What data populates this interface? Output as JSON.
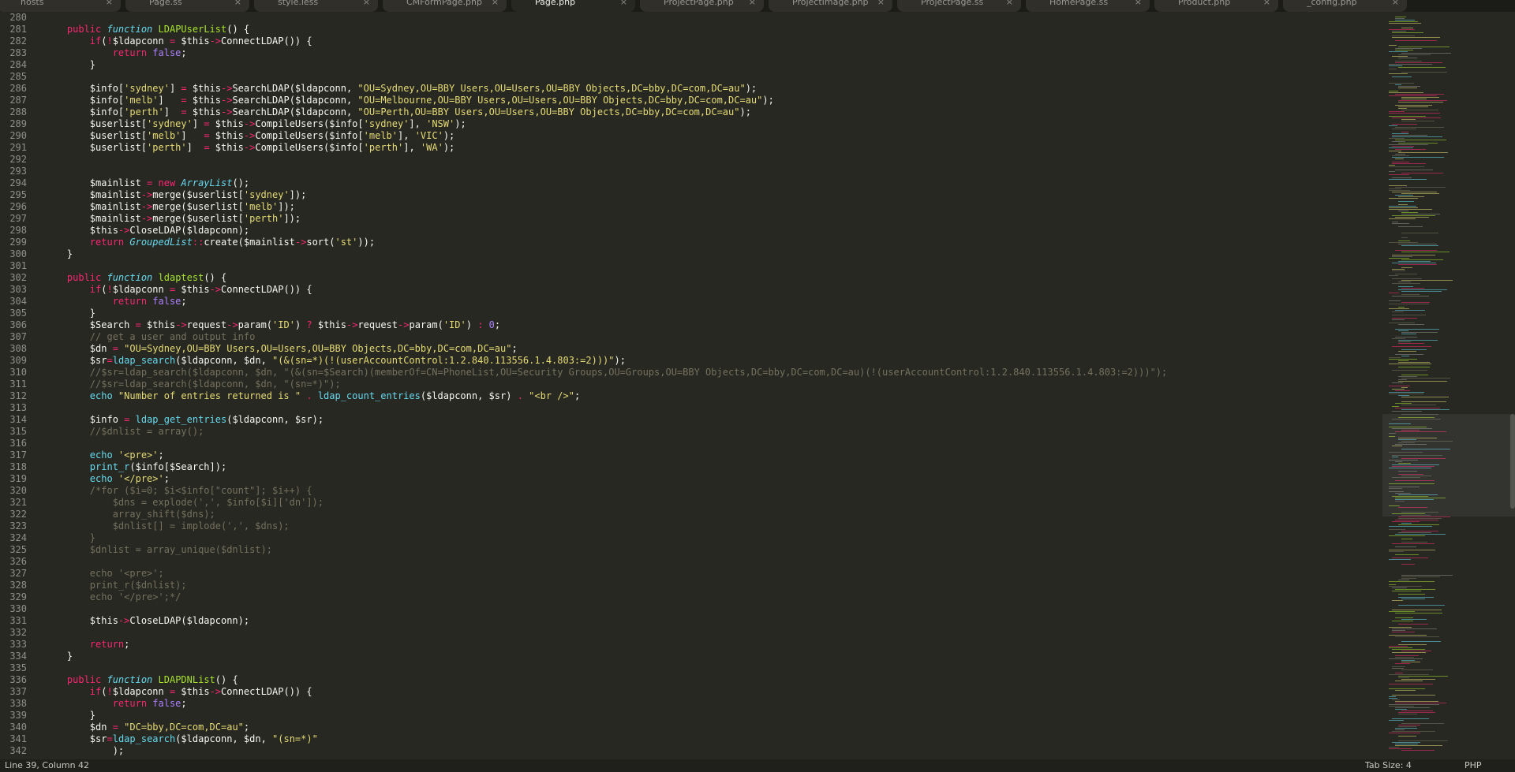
{
  "tabs": [
    {
      "label": "hosts",
      "active": false
    },
    {
      "label": "Page.ss",
      "active": false
    },
    {
      "label": "style.less",
      "active": false
    },
    {
      "label": "CMFormPage.php",
      "active": false
    },
    {
      "label": "Page.php",
      "active": true
    },
    {
      "label": "ProjectPage.php",
      "active": false
    },
    {
      "label": "ProjectImage.php",
      "active": false
    },
    {
      "label": "ProjectPage.ss",
      "active": false
    },
    {
      "label": "HomePage.ss",
      "active": false
    },
    {
      "label": "Product.php",
      "active": false
    },
    {
      "label": "_config.php",
      "active": false
    }
  ],
  "tab_close_glyph": "×",
  "status": {
    "position": "Line 39, Column 42",
    "tab_size": "Tab Size: 4",
    "syntax": "PHP"
  },
  "colors": {
    "background": "#272822",
    "keyword": "#f92672",
    "function": "#a6e22e",
    "string": "#e6db74",
    "storage": "#66d9ef",
    "comment": "#75715e",
    "constant": "#ae81ff",
    "text": "#f8f8f2"
  },
  "lines": [
    {
      "n": "280",
      "t": []
    },
    {
      "n": "281",
      "t": [
        [
          "tx",
          "    "
        ],
        [
          "kw",
          "public "
        ],
        [
          "it",
          "function "
        ],
        [
          "fn",
          "LDAPUserList"
        ],
        [
          "tx",
          "() {"
        ]
      ]
    },
    {
      "n": "282",
      "t": [
        [
          "tx",
          "        "
        ],
        [
          "kw",
          "if"
        ],
        [
          "tx",
          "("
        ],
        [
          "kw",
          "!"
        ],
        [
          "tx",
          "$ldapconn "
        ],
        [
          "kw",
          "="
        ],
        [
          "tx",
          " $this"
        ],
        [
          "kw",
          "->"
        ],
        [
          "tx",
          "ConnectLDAP()) {"
        ]
      ]
    },
    {
      "n": "283",
      "t": [
        [
          "tx",
          "            "
        ],
        [
          "kw",
          "return "
        ],
        [
          "nu",
          "false"
        ],
        [
          "tx",
          ";"
        ]
      ]
    },
    {
      "n": "284",
      "t": [
        [
          "tx",
          "        }"
        ]
      ]
    },
    {
      "n": "285",
      "t": []
    },
    {
      "n": "286",
      "t": [
        [
          "tx",
          "        $info["
        ],
        [
          "st",
          "'sydney'"
        ],
        [
          "tx",
          "] "
        ],
        [
          "kw",
          "="
        ],
        [
          "tx",
          " $this"
        ],
        [
          "kw",
          "->"
        ],
        [
          "tx",
          "SearchLDAP($ldapconn, "
        ],
        [
          "st",
          "\"OU=Sydney,OU=BBY Users,OU=Users,OU=BBY Objects,DC=bby,DC=com,DC=au\""
        ],
        [
          "tx",
          ");"
        ]
      ]
    },
    {
      "n": "287",
      "t": [
        [
          "tx",
          "        $info["
        ],
        [
          "st",
          "'melb'"
        ],
        [
          "tx",
          "]   "
        ],
        [
          "kw",
          "="
        ],
        [
          "tx",
          " $this"
        ],
        [
          "kw",
          "->"
        ],
        [
          "tx",
          "SearchLDAP($ldapconn, "
        ],
        [
          "st",
          "\"OU=Melbourne,OU=BBY Users,OU=Users,OU=BBY Objects,DC=bby,DC=com,DC=au\""
        ],
        [
          "tx",
          ");"
        ]
      ]
    },
    {
      "n": "288",
      "t": [
        [
          "tx",
          "        $info["
        ],
        [
          "st",
          "'perth'"
        ],
        [
          "tx",
          "]  "
        ],
        [
          "kw",
          "="
        ],
        [
          "tx",
          " $this"
        ],
        [
          "kw",
          "->"
        ],
        [
          "tx",
          "SearchLDAP($ldapconn, "
        ],
        [
          "st",
          "\"OU=Perth,OU=BBY Users,OU=Users,OU=BBY Objects,DC=bby,DC=com,DC=au\""
        ],
        [
          "tx",
          ");"
        ]
      ]
    },
    {
      "n": "289",
      "t": [
        [
          "tx",
          "        $userlist["
        ],
        [
          "st",
          "'sydney'"
        ],
        [
          "tx",
          "] "
        ],
        [
          "kw",
          "="
        ],
        [
          "tx",
          " $this"
        ],
        [
          "kw",
          "->"
        ],
        [
          "tx",
          "CompileUsers($info["
        ],
        [
          "st",
          "'sydney'"
        ],
        [
          "tx",
          "], "
        ],
        [
          "st",
          "'NSW'"
        ],
        [
          "tx",
          ");"
        ]
      ]
    },
    {
      "n": "290",
      "t": [
        [
          "tx",
          "        $userlist["
        ],
        [
          "st",
          "'melb'"
        ],
        [
          "tx",
          "]   "
        ],
        [
          "kw",
          "="
        ],
        [
          "tx",
          " $this"
        ],
        [
          "kw",
          "->"
        ],
        [
          "tx",
          "CompileUsers($info["
        ],
        [
          "st",
          "'melb'"
        ],
        [
          "tx",
          "], "
        ],
        [
          "st",
          "'VIC'"
        ],
        [
          "tx",
          ");"
        ]
      ]
    },
    {
      "n": "291",
      "t": [
        [
          "tx",
          "        $userlist["
        ],
        [
          "st",
          "'perth'"
        ],
        [
          "tx",
          "]  "
        ],
        [
          "kw",
          "="
        ],
        [
          "tx",
          " $this"
        ],
        [
          "kw",
          "->"
        ],
        [
          "tx",
          "CompileUsers($info["
        ],
        [
          "st",
          "'perth'"
        ],
        [
          "tx",
          "], "
        ],
        [
          "st",
          "'WA'"
        ],
        [
          "tx",
          ");"
        ]
      ]
    },
    {
      "n": "292",
      "t": []
    },
    {
      "n": "293",
      "t": []
    },
    {
      "n": "294",
      "t": [
        [
          "tx",
          "        $mainlist "
        ],
        [
          "kw",
          "= new "
        ],
        [
          "it",
          "ArrayList"
        ],
        [
          "tx",
          "();"
        ]
      ]
    },
    {
      "n": "295",
      "t": [
        [
          "tx",
          "        $mainlist"
        ],
        [
          "kw",
          "->"
        ],
        [
          "tx",
          "merge($userlist["
        ],
        [
          "st",
          "'sydney'"
        ],
        [
          "tx",
          "]);"
        ]
      ]
    },
    {
      "n": "296",
      "t": [
        [
          "tx",
          "        $mainlist"
        ],
        [
          "kw",
          "->"
        ],
        [
          "tx",
          "merge($userlist["
        ],
        [
          "st",
          "'melb'"
        ],
        [
          "tx",
          "]);"
        ]
      ]
    },
    {
      "n": "297",
      "t": [
        [
          "tx",
          "        $mainlist"
        ],
        [
          "kw",
          "->"
        ],
        [
          "tx",
          "merge($userlist["
        ],
        [
          "st",
          "'perth'"
        ],
        [
          "tx",
          "]);"
        ]
      ]
    },
    {
      "n": "298",
      "t": [
        [
          "tx",
          "        $this"
        ],
        [
          "kw",
          "->"
        ],
        [
          "tx",
          "CloseLDAP($ldapconn);"
        ]
      ]
    },
    {
      "n": "299",
      "t": [
        [
          "tx",
          "        "
        ],
        [
          "kw",
          "return "
        ],
        [
          "it",
          "GroupedList"
        ],
        [
          "kw",
          "::"
        ],
        [
          "tx",
          "create($mainlist"
        ],
        [
          "kw",
          "->"
        ],
        [
          "tx",
          "sort("
        ],
        [
          "st",
          "'st'"
        ],
        [
          "tx",
          "));"
        ]
      ]
    },
    {
      "n": "300",
      "t": [
        [
          "tx",
          "    }"
        ]
      ]
    },
    {
      "n": "301",
      "t": []
    },
    {
      "n": "302",
      "t": [
        [
          "tx",
          "    "
        ],
        [
          "kw",
          "public "
        ],
        [
          "it",
          "function "
        ],
        [
          "fn",
          "ldaptest"
        ],
        [
          "tx",
          "() {"
        ]
      ]
    },
    {
      "n": "303",
      "t": [
        [
          "tx",
          "        "
        ],
        [
          "kw",
          "if"
        ],
        [
          "tx",
          "("
        ],
        [
          "kw",
          "!"
        ],
        [
          "tx",
          "$ldapconn "
        ],
        [
          "kw",
          "="
        ],
        [
          "tx",
          " $this"
        ],
        [
          "kw",
          "->"
        ],
        [
          "tx",
          "ConnectLDAP()) {"
        ]
      ]
    },
    {
      "n": "304",
      "t": [
        [
          "tx",
          "            "
        ],
        [
          "kw",
          "return "
        ],
        [
          "nu",
          "false"
        ],
        [
          "tx",
          ";"
        ]
      ]
    },
    {
      "n": "305",
      "t": [
        [
          "tx",
          "        }"
        ]
      ]
    },
    {
      "n": "306",
      "t": [
        [
          "tx",
          "        $Search "
        ],
        [
          "kw",
          "="
        ],
        [
          "tx",
          " $this"
        ],
        [
          "kw",
          "->"
        ],
        [
          "tx",
          "request"
        ],
        [
          "kw",
          "->"
        ],
        [
          "tx",
          "param("
        ],
        [
          "st",
          "'ID'"
        ],
        [
          "tx",
          ") "
        ],
        [
          "kw",
          "?"
        ],
        [
          "tx",
          " $this"
        ],
        [
          "kw",
          "->"
        ],
        [
          "tx",
          "request"
        ],
        [
          "kw",
          "->"
        ],
        [
          "tx",
          "param("
        ],
        [
          "st",
          "'ID'"
        ],
        [
          "tx",
          ") "
        ],
        [
          "kw",
          ":"
        ],
        [
          "tx",
          " "
        ],
        [
          "nu",
          "0"
        ],
        [
          "tx",
          ";"
        ]
      ]
    },
    {
      "n": "307",
      "t": [
        [
          "tx",
          "        "
        ],
        [
          "co",
          "// get a user and output info"
        ]
      ]
    },
    {
      "n": "308",
      "t": [
        [
          "tx",
          "        $dn "
        ],
        [
          "kw",
          "="
        ],
        [
          "tx",
          " "
        ],
        [
          "st",
          "\"OU=Sydney,OU=BBY Users,OU=Users,OU=BBY Objects,DC=bby,DC=com,DC=au\""
        ],
        [
          "tx",
          ";"
        ]
      ]
    },
    {
      "n": "309",
      "t": [
        [
          "tx",
          "        $sr"
        ],
        [
          "kw",
          "="
        ],
        [
          "bf",
          "ldap_search"
        ],
        [
          "tx",
          "($ldapconn, $dn, "
        ],
        [
          "st",
          "\"(&(sn=*)(!(userAccountControl:1.2.840.113556.1.4.803:=2)))\""
        ],
        [
          "tx",
          ");"
        ]
      ]
    },
    {
      "n": "310",
      "t": [
        [
          "tx",
          "        "
        ],
        [
          "co",
          "//$sr=ldap_search($ldapconn, $dn, \"(&(sn=$Search)(memberOf=CN=PhoneList,OU=Security Groups,OU=Groups,OU=BBY Objects,DC=bby,DC=com,DC=au)(!(userAccountControl:1.2.840.113556.1.4.803:=2)))\");"
        ]
      ]
    },
    {
      "n": "311",
      "t": [
        [
          "tx",
          "        "
        ],
        [
          "co",
          "//$sr=ldap_search($ldapconn, $dn, \"(sn=*)\");"
        ]
      ]
    },
    {
      "n": "312",
      "t": [
        [
          "tx",
          "        "
        ],
        [
          "bf",
          "echo "
        ],
        [
          "st",
          "\"Number of entries returned is \""
        ],
        [
          "tx",
          " "
        ],
        [
          "kw",
          "."
        ],
        [
          "tx",
          " "
        ],
        [
          "bf",
          "ldap_count_entries"
        ],
        [
          "tx",
          "($ldapconn, $sr) "
        ],
        [
          "kw",
          "."
        ],
        [
          "tx",
          " "
        ],
        [
          "st",
          "\"<br />\""
        ],
        [
          "tx",
          ";"
        ]
      ]
    },
    {
      "n": "313",
      "t": []
    },
    {
      "n": "314",
      "t": [
        [
          "tx",
          "        $info "
        ],
        [
          "kw",
          "="
        ],
        [
          "tx",
          " "
        ],
        [
          "bf",
          "ldap_get_entries"
        ],
        [
          "tx",
          "($ldapconn, $sr);"
        ]
      ]
    },
    {
      "n": "315",
      "t": [
        [
          "tx",
          "        "
        ],
        [
          "co",
          "//$dnlist = array();"
        ]
      ]
    },
    {
      "n": "316",
      "t": []
    },
    {
      "n": "317",
      "t": [
        [
          "tx",
          "        "
        ],
        [
          "bf",
          "echo "
        ],
        [
          "st",
          "'<pre>'"
        ],
        [
          "tx",
          ";"
        ]
      ]
    },
    {
      "n": "318",
      "t": [
        [
          "tx",
          "        "
        ],
        [
          "bf",
          "print_r"
        ],
        [
          "tx",
          "($info[$Search]);"
        ]
      ]
    },
    {
      "n": "319",
      "t": [
        [
          "tx",
          "        "
        ],
        [
          "bf",
          "echo "
        ],
        [
          "st",
          "'</pre>'"
        ],
        [
          "tx",
          ";"
        ]
      ]
    },
    {
      "n": "320",
      "t": [
        [
          "tx",
          "        "
        ],
        [
          "co",
          "/*for ($i=0; $i<$info[\"count\"]; $i++) {"
        ]
      ]
    },
    {
      "n": "321",
      "t": [
        [
          "co",
          "            $dns = explode(',', $info[$i]['dn']);"
        ]
      ]
    },
    {
      "n": "322",
      "t": [
        [
          "co",
          "            array_shift($dns);"
        ]
      ]
    },
    {
      "n": "323",
      "t": [
        [
          "co",
          "            $dnlist[] = implode(',', $dns);"
        ]
      ]
    },
    {
      "n": "324",
      "t": [
        [
          "co",
          "        }"
        ]
      ]
    },
    {
      "n": "325",
      "t": [
        [
          "co",
          "        $dnlist = array_unique($dnlist);"
        ]
      ]
    },
    {
      "n": "326",
      "t": []
    },
    {
      "n": "327",
      "t": [
        [
          "co",
          "        echo '<pre>';"
        ]
      ]
    },
    {
      "n": "328",
      "t": [
        [
          "co",
          "        print_r($dnlist);"
        ]
      ]
    },
    {
      "n": "329",
      "t": [
        [
          "co",
          "        echo '</pre>';*/"
        ]
      ]
    },
    {
      "n": "330",
      "t": []
    },
    {
      "n": "331",
      "t": [
        [
          "tx",
          "        $this"
        ],
        [
          "kw",
          "->"
        ],
        [
          "tx",
          "CloseLDAP($ldapconn);"
        ]
      ]
    },
    {
      "n": "332",
      "t": []
    },
    {
      "n": "333",
      "t": [
        [
          "tx",
          "        "
        ],
        [
          "kw",
          "return"
        ],
        [
          "tx",
          ";"
        ]
      ]
    },
    {
      "n": "334",
      "t": [
        [
          "tx",
          "    }"
        ]
      ]
    },
    {
      "n": "335",
      "t": []
    },
    {
      "n": "336",
      "t": [
        [
          "tx",
          "    "
        ],
        [
          "kw",
          "public "
        ],
        [
          "it",
          "function "
        ],
        [
          "fn",
          "LDAPDNList"
        ],
        [
          "tx",
          "() {"
        ]
      ]
    },
    {
      "n": "337",
      "t": [
        [
          "tx",
          "        "
        ],
        [
          "kw",
          "if"
        ],
        [
          "tx",
          "("
        ],
        [
          "kw",
          "!"
        ],
        [
          "tx",
          "$ldapconn "
        ],
        [
          "kw",
          "="
        ],
        [
          "tx",
          " $this"
        ],
        [
          "kw",
          "->"
        ],
        [
          "tx",
          "ConnectLDAP()) {"
        ]
      ]
    },
    {
      "n": "338",
      "t": [
        [
          "tx",
          "            "
        ],
        [
          "kw",
          "return "
        ],
        [
          "nu",
          "false"
        ],
        [
          "tx",
          ";"
        ]
      ]
    },
    {
      "n": "339",
      "t": [
        [
          "tx",
          "        }"
        ]
      ]
    },
    {
      "n": "340",
      "t": [
        [
          "tx",
          "        $dn "
        ],
        [
          "kw",
          "="
        ],
        [
          "tx",
          " "
        ],
        [
          "st",
          "\"DC=bby,DC=com,DC=au\""
        ],
        [
          "tx",
          ";"
        ]
      ]
    },
    {
      "n": "341",
      "t": [
        [
          "tx",
          "        $sr"
        ],
        [
          "kw",
          "="
        ],
        [
          "bf",
          "ldap_search"
        ],
        [
          "tx",
          "($ldapconn, $dn, "
        ],
        [
          "st",
          "\"(sn=*)\""
        ]
      ]
    },
    {
      "n": "342",
      "t": [
        [
          "tx",
          "            );"
        ]
      ]
    }
  ]
}
